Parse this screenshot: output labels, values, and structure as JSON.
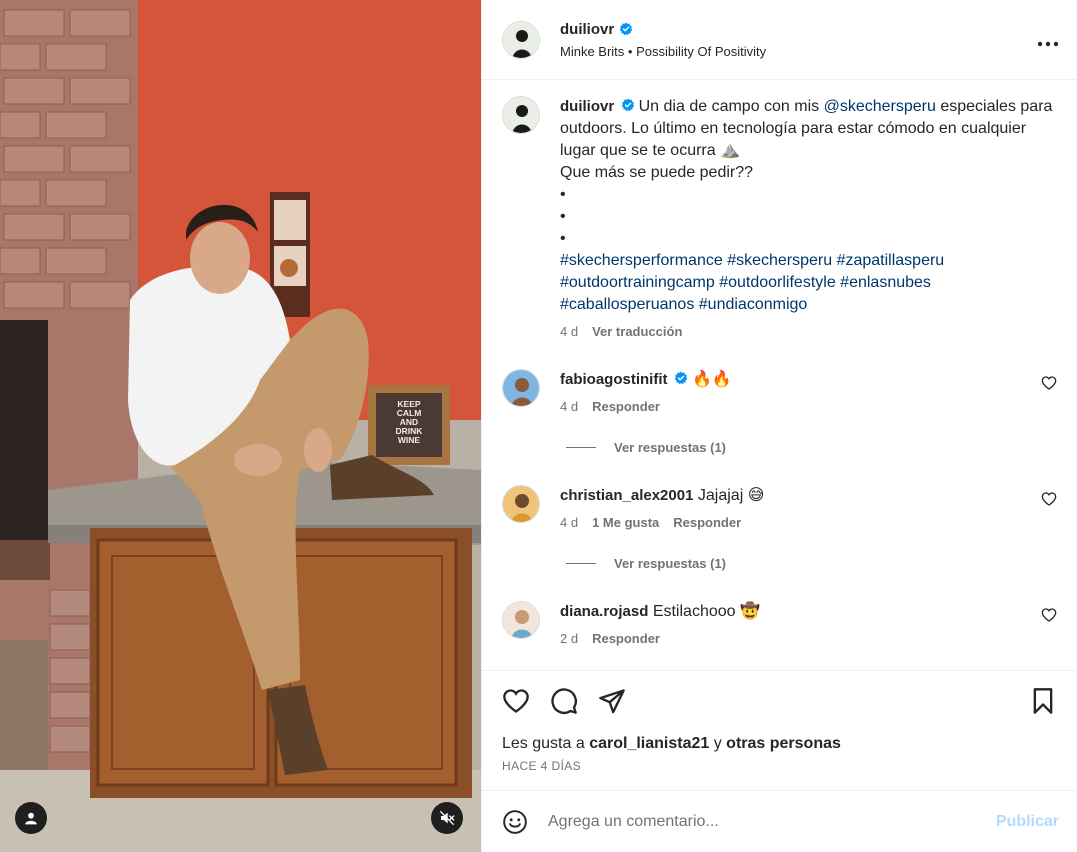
{
  "colors": {
    "accent": "#0095f6",
    "link": "#00376b",
    "muted": "#737373",
    "publish_disabled": "#b3dbff"
  },
  "post": {
    "author": "duiliovr",
    "audio_artist": "Minke Brits",
    "audio_separator": "•",
    "audio_title": "Possibility Of Positivity",
    "more_icon": "more-horizontal-icon"
  },
  "caption": {
    "username": "duiliovr",
    "text_1": "Un dia de campo con mis ",
    "mention": "@skechersperu",
    "text_2": " especiales para outdoors. Lo último en tecnología para estar cómodo en cualquier lugar que se te ocurra ⛰️",
    "line_2": "Que más se puede pedir??",
    "bullet_1": "•",
    "bullet_2": "•",
    "bullet_3": "•",
    "hashtags": "#skechersperformance #skechersperu #zapatillasperu #outdoortrainingcamp #outdoorlifestyle #enlasnubes #caballosperuanos #undiaconmigo",
    "time": "4 d",
    "translate_label": "Ver traducción"
  },
  "comments": [
    {
      "username": "fabioagostinifit",
      "verified": true,
      "text": "🔥🔥",
      "time": "4 d",
      "likes_label": "",
      "reply_label": "Responder",
      "replies_label": "Ver respuestas (1)"
    },
    {
      "username": "christian_alex2001",
      "verified": false,
      "text": "Jajajaj 😅",
      "time": "4 d",
      "likes_label": "1 Me gusta",
      "reply_label": "Responder",
      "replies_label": "Ver respuestas (1)"
    },
    {
      "username": "diana.rojasd",
      "verified": false,
      "text": "Estilachooo 🤠",
      "time": "2 d",
      "likes_label": "",
      "reply_label": "Responder",
      "replies_label": ""
    }
  ],
  "likes": {
    "prefix": "Les gusta a",
    "user": "carol_lianista21",
    "connector": "y",
    "others": "otras personas"
  },
  "date_label": "HACE 4 DÍAS",
  "add_comment": {
    "placeholder": "Agrega un comentario...",
    "publish_label": "Publicar"
  },
  "media": {
    "sign_lines": [
      "KEEP",
      "CALM",
      "AND",
      "DRINK",
      "WINE"
    ]
  }
}
